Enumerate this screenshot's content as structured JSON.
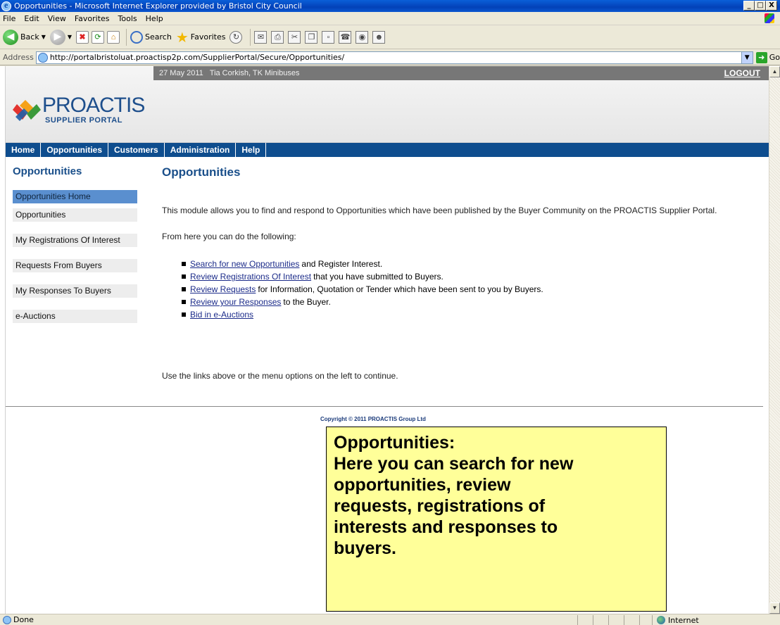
{
  "window": {
    "title": "Opportunities - Microsoft Internet Explorer provided by Bristol City Council",
    "controls": [
      "_",
      "□",
      "X"
    ]
  },
  "menubar": [
    "File",
    "Edit",
    "View",
    "Favorites",
    "Tools",
    "Help"
  ],
  "toolbar": {
    "back_label": "Back",
    "search_label": "Search",
    "favorites_label": "Favorites"
  },
  "address": {
    "label": "Address",
    "url": "http://portalbristoluat.proactisp2p.com/SupplierPortal/Secure/Opportunities/",
    "go_label": "Go"
  },
  "portal": {
    "info": "27 May 2011   Tia Corkish, TK Minibuses",
    "logout": "LOGOUT",
    "logo_word": "PROACTIS",
    "logo_sub": "SUPPLIER PORTAL",
    "brand_colors": {
      "nav": "#0e4d8e",
      "heading": "#1a4f8a",
      "active_item": "#5a8fcf"
    },
    "nav": [
      "Home",
      "Opportunities",
      "Customers",
      "Administration",
      "Help"
    ]
  },
  "sidebar": {
    "title": "Opportunities",
    "items": [
      {
        "label": "Opportunities Home",
        "active": true
      },
      {
        "label": "Opportunities",
        "active": false
      },
      {
        "label": "My Registrations Of Interest",
        "active": false
      },
      {
        "label": "Requests From Buyers",
        "active": false
      },
      {
        "label": "My Responses To Buyers",
        "active": false
      },
      {
        "label": "e-Auctions",
        "active": false
      }
    ]
  },
  "main": {
    "title": "Opportunities",
    "intro": "This module allows you to find and respond to Opportunities which have been published by the Buyer Community on the PROACTIS Supplier Portal.",
    "lead": "From here you can do the following:",
    "bullets": [
      {
        "link": "Search for new Opportunities",
        "text": "and Register Interest."
      },
      {
        "link": "Review Registrations Of Interest",
        "text": "that you have submitted to Buyers."
      },
      {
        "link": "Review Requests",
        "text": "for Information, Quotation or Tender which have been sent to you by Buyers."
      },
      {
        "link": "Review your Responses",
        "text": "to the Buyer."
      },
      {
        "link": "Bid in e-Auctions",
        "text": ""
      }
    ],
    "footer_note": "Use the links above or the menu options on the left to continue.",
    "copyright": "Copyright © 2011 PROACTIS Group Ltd"
  },
  "callout": {
    "lines": [
      "Opportunities:",
      "Here you can search for new",
      "opportunities, review",
      "requests, registrations of",
      "interests and responses to",
      "buyers."
    ],
    "color": "#ffff99"
  },
  "statusbar": {
    "status": "Done",
    "zone": "Internet"
  }
}
